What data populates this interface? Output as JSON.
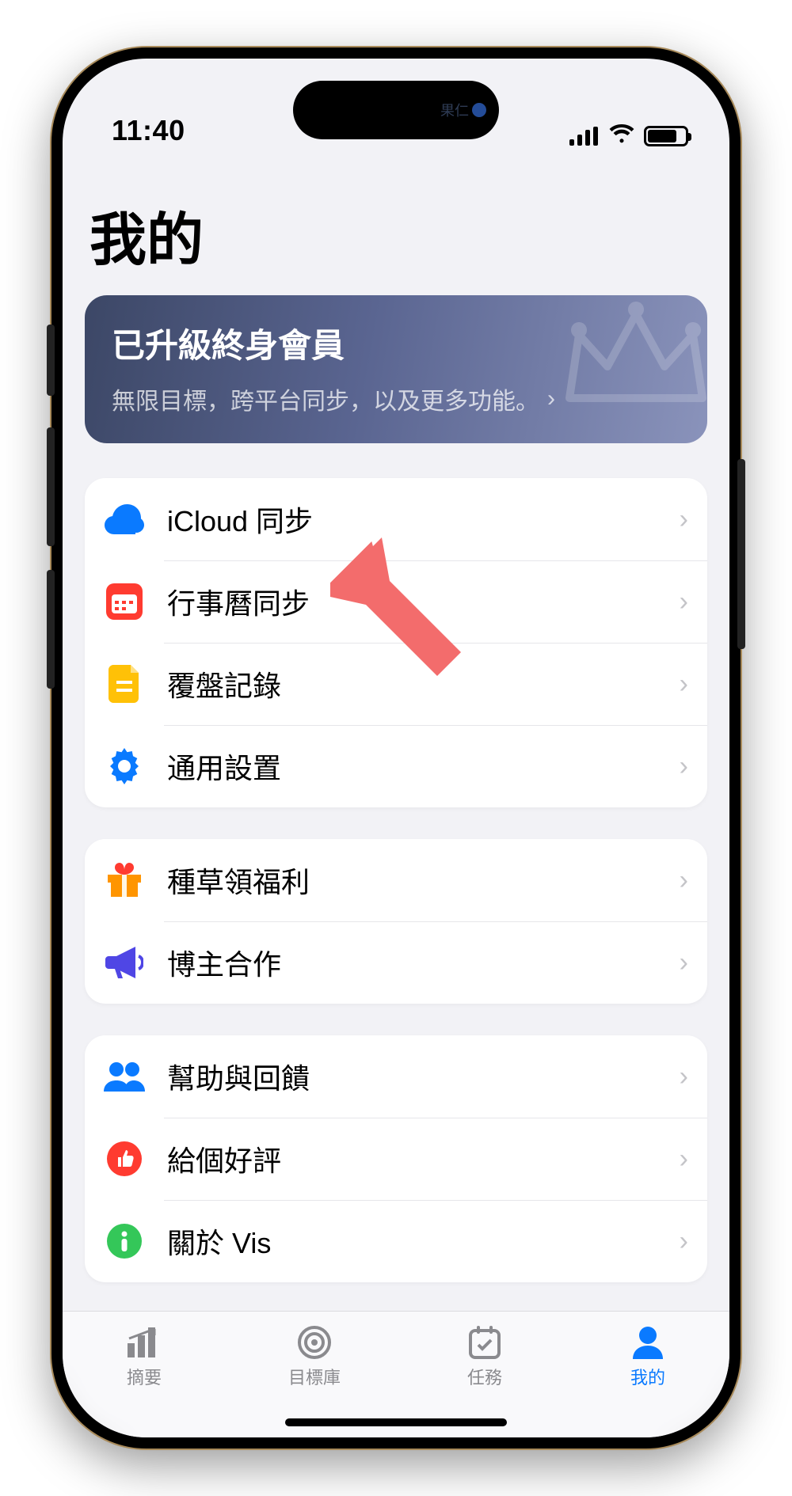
{
  "status": {
    "time": "11:40",
    "island_text": "果仁"
  },
  "page": {
    "title": "我的"
  },
  "premium": {
    "title": "已升級終身會員",
    "subtitle": "無限目標，跨平台同步，以及更多功能。"
  },
  "sections": [
    {
      "rows": [
        {
          "icon": "cloud-icon",
          "color": "#0a7aff",
          "label": "iCloud 同步"
        },
        {
          "icon": "calendar-icon",
          "color": "#ff3b30",
          "label": "行事曆同步"
        },
        {
          "icon": "document-icon",
          "color": "#ffc107",
          "label": "覆盤記錄"
        },
        {
          "icon": "gear-icon",
          "color": "#0a7aff",
          "label": "通用設置"
        }
      ]
    },
    {
      "rows": [
        {
          "icon": "gift-icon",
          "color": "#ff9500",
          "label": "種草領福利"
        },
        {
          "icon": "megaphone-icon",
          "color": "#4f46e5",
          "label": "博主合作"
        }
      ]
    },
    {
      "rows": [
        {
          "icon": "people-icon",
          "color": "#0a7aff",
          "label": "幫助與回饋"
        },
        {
          "icon": "thumb-icon",
          "color": "#ff3b30",
          "label": "給個好評"
        },
        {
          "icon": "info-icon",
          "color": "#34c759",
          "label": "關於 Vis"
        }
      ]
    }
  ],
  "tabs": [
    {
      "icon": "chart-icon",
      "label": "摘要",
      "active": false
    },
    {
      "icon": "target-icon",
      "label": "目標庫",
      "active": false
    },
    {
      "icon": "task-icon",
      "label": "任務",
      "active": false
    },
    {
      "icon": "person-icon",
      "label": "我的",
      "active": true
    }
  ]
}
